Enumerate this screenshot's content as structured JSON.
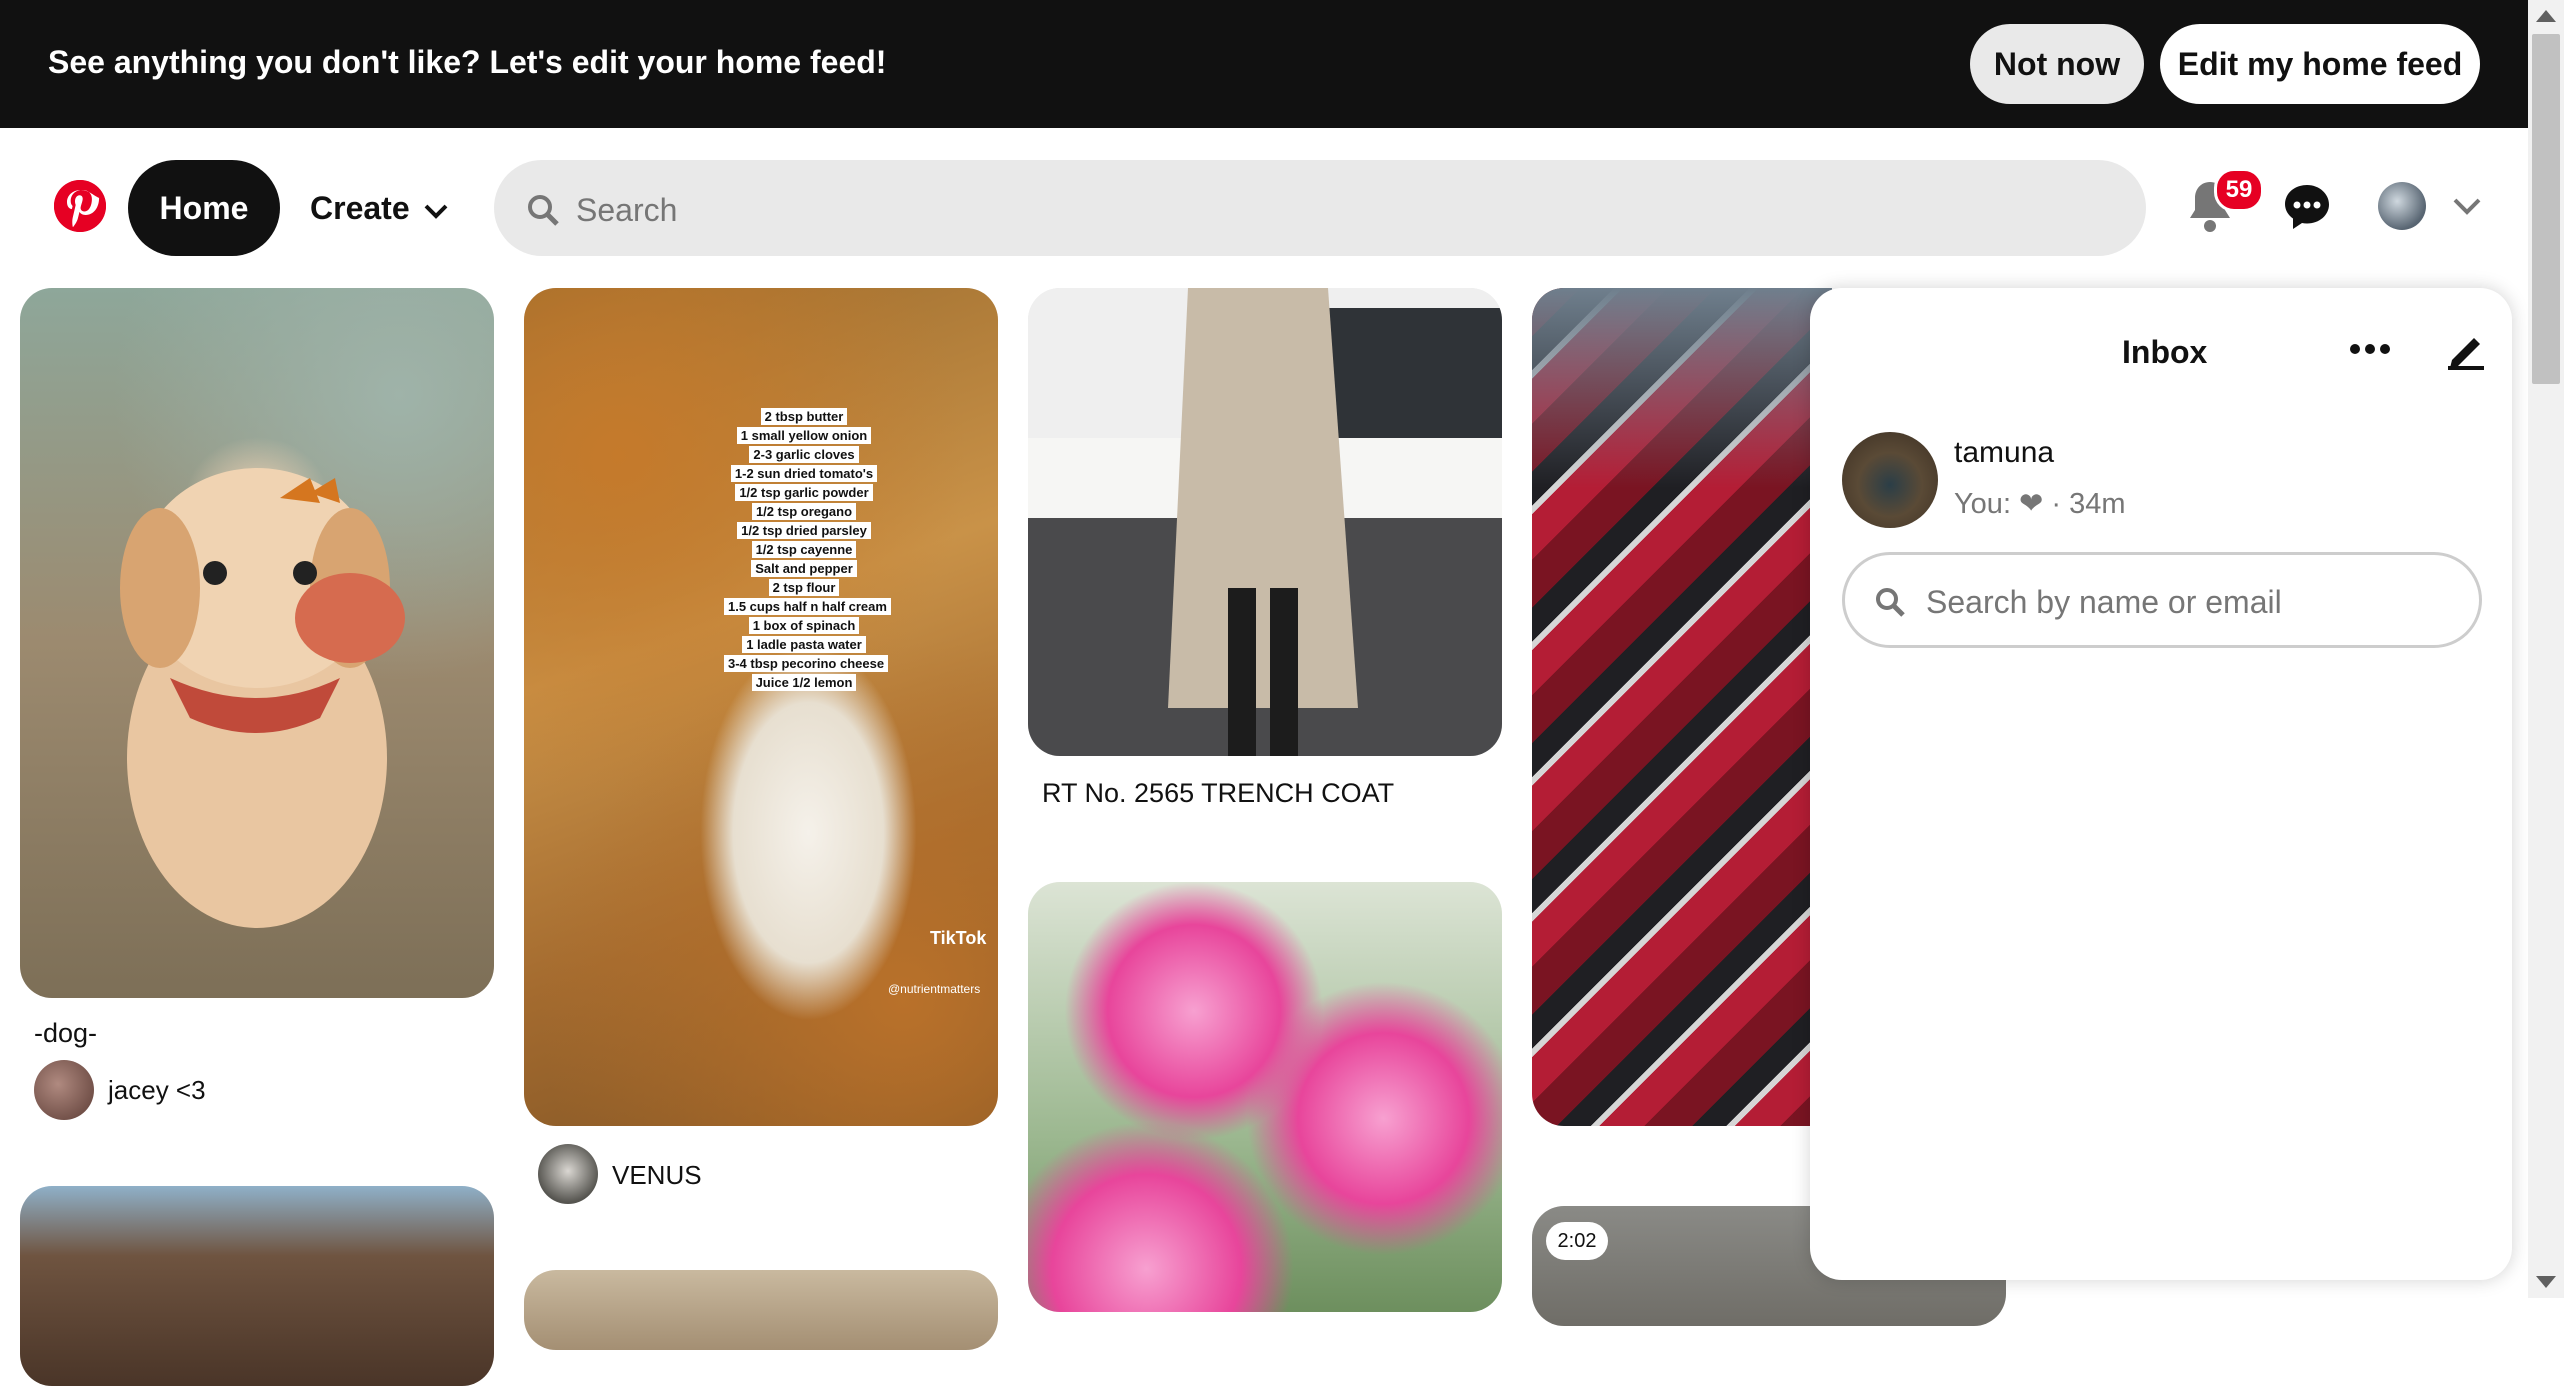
{
  "banner": {
    "text": "See anything you don't like? Let's edit your home feed!",
    "not_now": "Not now",
    "edit_feed": "Edit my home feed"
  },
  "header": {
    "home": "Home",
    "create": "Create",
    "search_placeholder": "Search",
    "notifications_count": "59",
    "icons": [
      "pinterest-logo-icon",
      "chevron-down-icon",
      "search-icon",
      "bell-icon",
      "chat-icon",
      "chevron-down-icon"
    ]
  },
  "pins": {
    "dog": {
      "title": "-dog-",
      "user": "jacey <3"
    },
    "food": {
      "user": "VENUS",
      "recipe": [
        "2 tbsp butter",
        "1 small yellow onion",
        "2-3 garlic cloves",
        "1-2 sun dried tomato's",
        "1/2 tsp garlic powder",
        "1/2 tsp oregano",
        "1/2 tsp dried parsley",
        "1/2 tsp cayenne",
        "Salt and pepper",
        "2 tsp flour",
        "1.5 cups half n half cream",
        "1 box of spinach",
        "1 ladle pasta water",
        "3-4 tbsp pecorino cheese",
        "Juice 1/2 lemon"
      ],
      "watermark": "TikTok",
      "handle": "@nutrientmatters"
    },
    "coat": {
      "title": "RT No. 2565 TRENCH COAT"
    },
    "video": {
      "duration": "2:02"
    }
  },
  "inbox": {
    "title": "Inbox",
    "conversation": {
      "name": "tamuna",
      "preview": "You: ❤ · 34m"
    },
    "search_placeholder": "Search by name or email"
  },
  "colors": {
    "brand": "#e60023",
    "banner_bg": "#111111",
    "search_bg": "#e9e9e9"
  }
}
